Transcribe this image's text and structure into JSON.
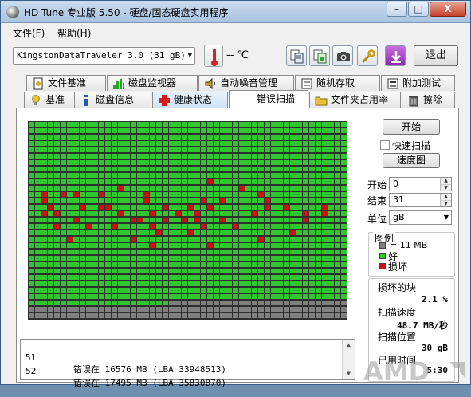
{
  "window": {
    "title": "HD Tune 专业版 5.50 - 硬盘/固态硬盘实用程序",
    "controls": {
      "minimize": "–",
      "maximize": "□",
      "close": "X"
    }
  },
  "menu": {
    "file": "文件(F)",
    "help": "帮助(H)"
  },
  "toolbar": {
    "drive": "KingstonDataTraveler 3.0 (31 gB)",
    "temperature": "-- ℃",
    "exit_label": "退出",
    "icons": [
      "copy-text-icon",
      "copy-info-icon",
      "screenshot-camera-icon",
      "options-wrench-icon",
      "download-icon"
    ]
  },
  "tabs": {
    "row1": [
      "文件基准",
      "磁盘监视器",
      "自动噪音管理",
      "随机存取",
      "附加测试"
    ],
    "row2": [
      "基准",
      "磁盘信息",
      "健康状态",
      "错误扫描",
      "文件夹占用率",
      "擦除"
    ],
    "active": "错误扫描"
  },
  "scan": {
    "grid_columns": 50,
    "grid_rows": 31,
    "scanned_blocks": 1422,
    "bad_blocks": [
      [
        28,
        9
      ],
      [
        14,
        10
      ],
      [
        33,
        10
      ],
      [
        2,
        11
      ],
      [
        5,
        11
      ],
      [
        11,
        11
      ],
      [
        36,
        11
      ],
      [
        2,
        12
      ],
      [
        7,
        11
      ],
      [
        18,
        11
      ],
      [
        27,
        12
      ],
      [
        30,
        12
      ],
      [
        37,
        12
      ],
      [
        18,
        12
      ],
      [
        37,
        13
      ],
      [
        3,
        13
      ],
      [
        8,
        13
      ],
      [
        11,
        13
      ],
      [
        12,
        13
      ],
      [
        21,
        13
      ],
      [
        25,
        13
      ],
      [
        28,
        13
      ],
      [
        40,
        13
      ],
      [
        46,
        13
      ],
      [
        23,
        14
      ],
      [
        26,
        14
      ],
      [
        35,
        14
      ],
      [
        43,
        14
      ],
      [
        46,
        14
      ],
      [
        11,
        13
      ],
      [
        14,
        14
      ],
      [
        19,
        14
      ],
      [
        2,
        14
      ],
      [
        4,
        14
      ],
      [
        24,
        15
      ],
      [
        30,
        15
      ],
      [
        43,
        15
      ],
      [
        7,
        15
      ],
      [
        16,
        15
      ],
      [
        21,
        15
      ],
      [
        26,
        15
      ],
      [
        17,
        15
      ],
      [
        32,
        16
      ],
      [
        4,
        16
      ],
      [
        9,
        16
      ],
      [
        13,
        16
      ],
      [
        19,
        16
      ],
      [
        27,
        16
      ],
      [
        20,
        17
      ],
      [
        25,
        17
      ],
      [
        41,
        17
      ],
      [
        36,
        18
      ],
      [
        16,
        18
      ],
      [
        6,
        18
      ],
      [
        28,
        19
      ],
      [
        19,
        19
      ]
    ]
  },
  "log": [
    {
      "index": "51",
      "message": "错误在 16576 MB (LBA 33948513)"
    },
    {
      "index": "52",
      "message": "错误在 17495 MB (LBA 35830870)"
    }
  ],
  "controls": {
    "start_button": "开始",
    "quick_scan_label": "快速扫描",
    "quick_scan_checked": false,
    "map_button": "速度图",
    "start_label": "开始",
    "start_value": "0",
    "end_label": "结束",
    "end_value": "31",
    "unit_label": "单位",
    "unit_value": "gB"
  },
  "legend": {
    "title": "图例",
    "block_size": "= 11 MB",
    "good": "好",
    "bad": "损坏",
    "colors": {
      "unscanned": "#808080",
      "good": "#2ec82e",
      "bad": "#cc1111",
      "grid": "#2f2f2f"
    }
  },
  "stats": {
    "bad_blocks_label": "损坏的块",
    "bad_blocks_value": "2.1 %",
    "scan_speed_label": "扫描速度",
    "scan_speed_value": "48.7 MB/秒",
    "scan_position_label": "扫描位置",
    "scan_position_value": "30 gB",
    "elapsed_label": "已用时间",
    "elapsed_value": "5:30"
  },
  "watermark": "AMD"
}
